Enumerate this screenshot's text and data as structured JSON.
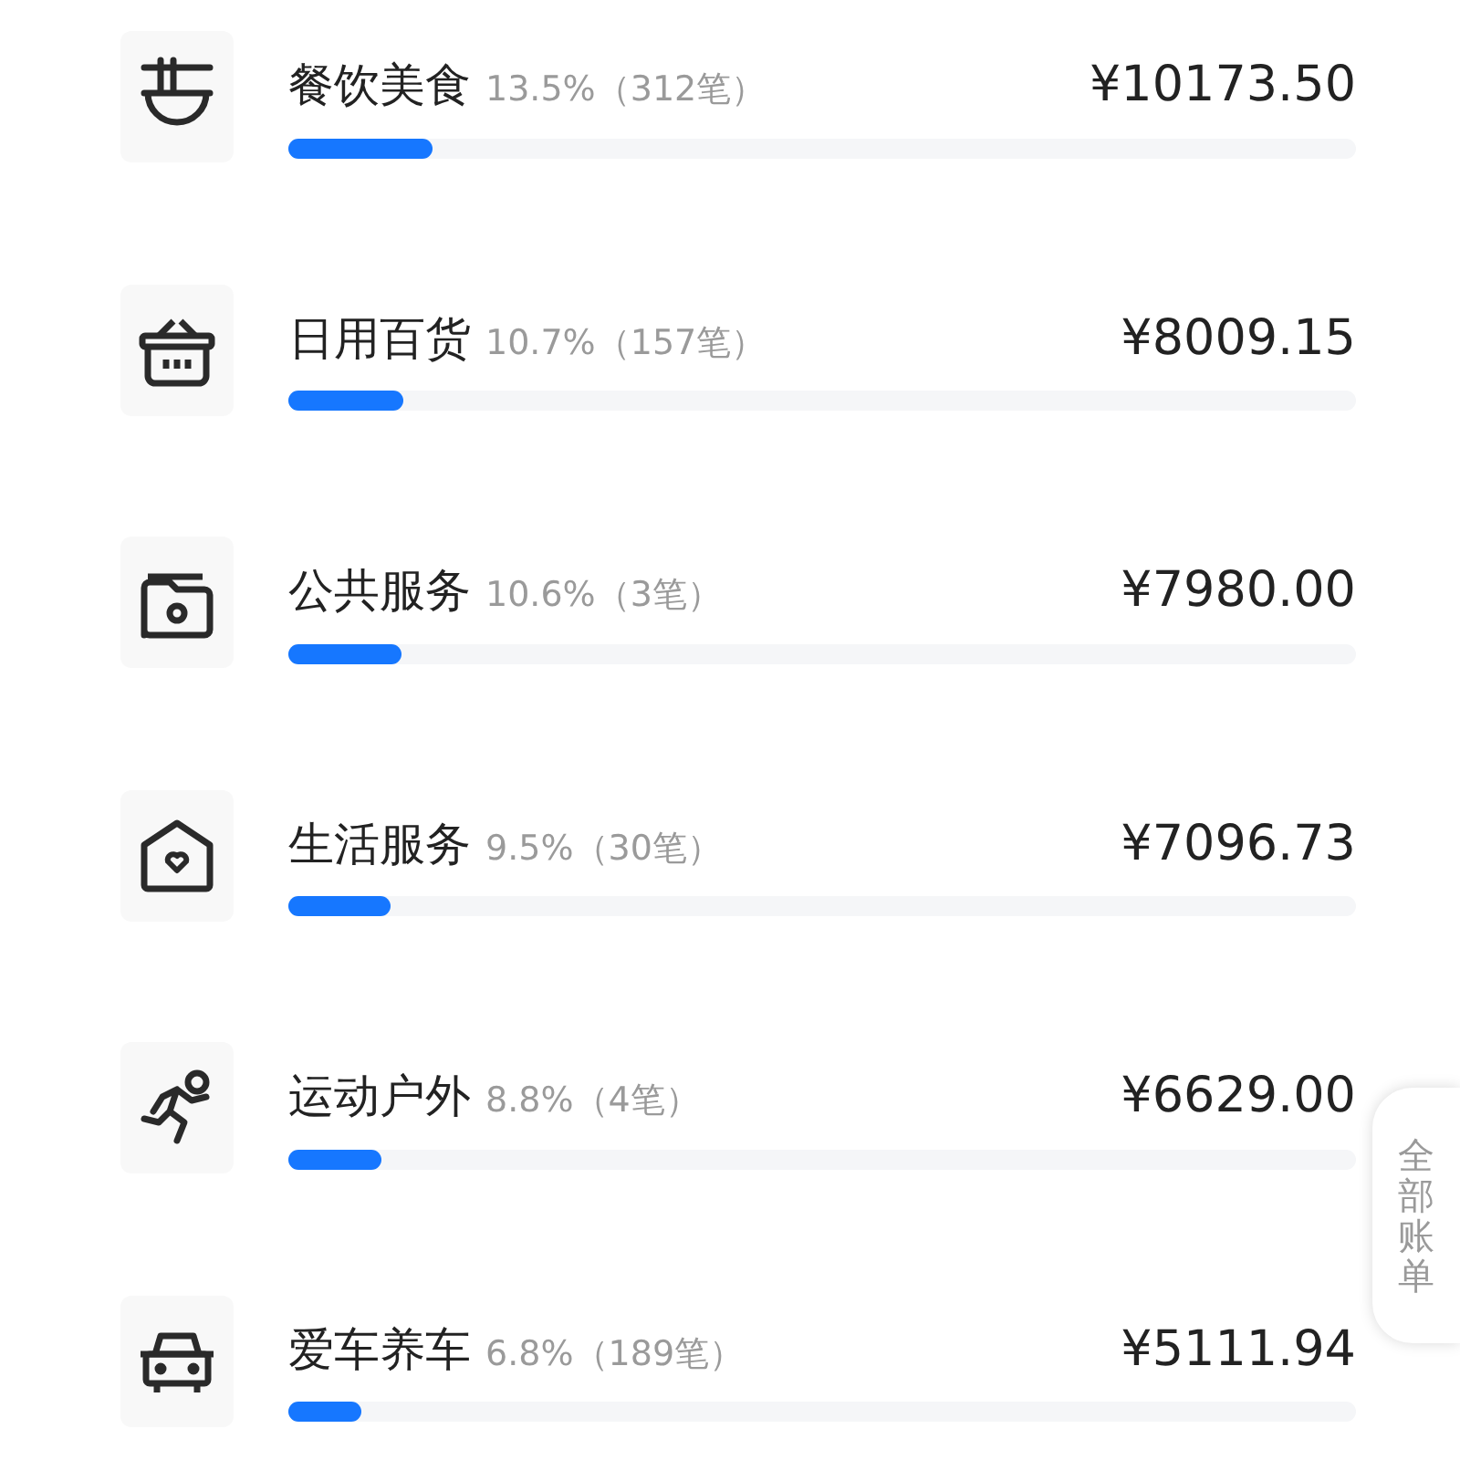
{
  "categories": [
    {
      "name": "餐饮美食",
      "share": "13.5%",
      "count": "（312笔）",
      "amount": "¥10173.50",
      "level": 0.135,
      "kind": "bowl"
    },
    {
      "name": "日用百货",
      "share": "10.7%",
      "count": "（157笔）",
      "amount": "¥8009.15",
      "level": 0.107,
      "kind": "basket"
    },
    {
      "name": "公共服务",
      "share": "10.6%",
      "count": "（3笔）",
      "amount": "¥7980.00",
      "level": 0.106,
      "kind": "folder"
    },
    {
      "name": "生活服务",
      "share": "9.5%",
      "count": "（30笔）",
      "amount": "¥7096.73",
      "level": 0.095,
      "kind": "house"
    },
    {
      "name": "运动户外",
      "share": "8.8%",
      "count": "（4笔）",
      "amount": "¥6629.00",
      "level": 0.088,
      "kind": "runner"
    },
    {
      "name": "爱车养车",
      "share": "6.8%",
      "count": "（189笔）",
      "amount": "¥5111.94",
      "level": 0.068,
      "kind": "car"
    }
  ],
  "side_tab": {
    "label": "全部账单"
  }
}
